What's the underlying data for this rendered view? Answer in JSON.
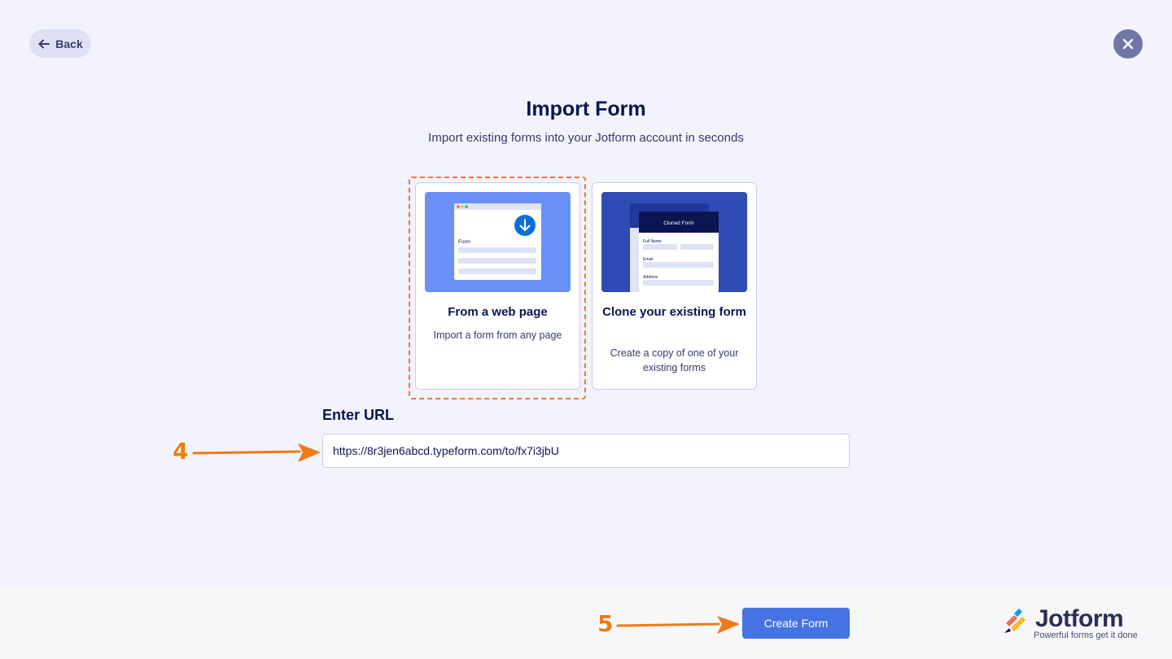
{
  "nav": {
    "back_label": "Back"
  },
  "header": {
    "title": "Import Form",
    "subtitle": "Import existing forms into your Jotform account in seconds"
  },
  "options": [
    {
      "title": "From a web page",
      "description": "Import a form from any page",
      "illustration_label": "Form",
      "selected": true
    },
    {
      "title": "Clone your existing form",
      "description": "Create a copy of one of your existing forms",
      "illustration_header": "Cloned Form",
      "fields": [
        "Full Name",
        "Email",
        "Address"
      ],
      "selected": false
    }
  ],
  "url_field": {
    "label": "Enter URL",
    "value": "https://8r3jen6abcd.typeform.com/to/fx7i3jbU"
  },
  "footer": {
    "create_label": "Create Form"
  },
  "brand": {
    "name": "Jotform",
    "tagline": "Powerful forms get it done"
  },
  "annotations": {
    "step_4": "4",
    "step_5": "5"
  },
  "colors": {
    "accent": "#4573e3",
    "annotation": "#f07a14",
    "title": "#0a1551"
  }
}
